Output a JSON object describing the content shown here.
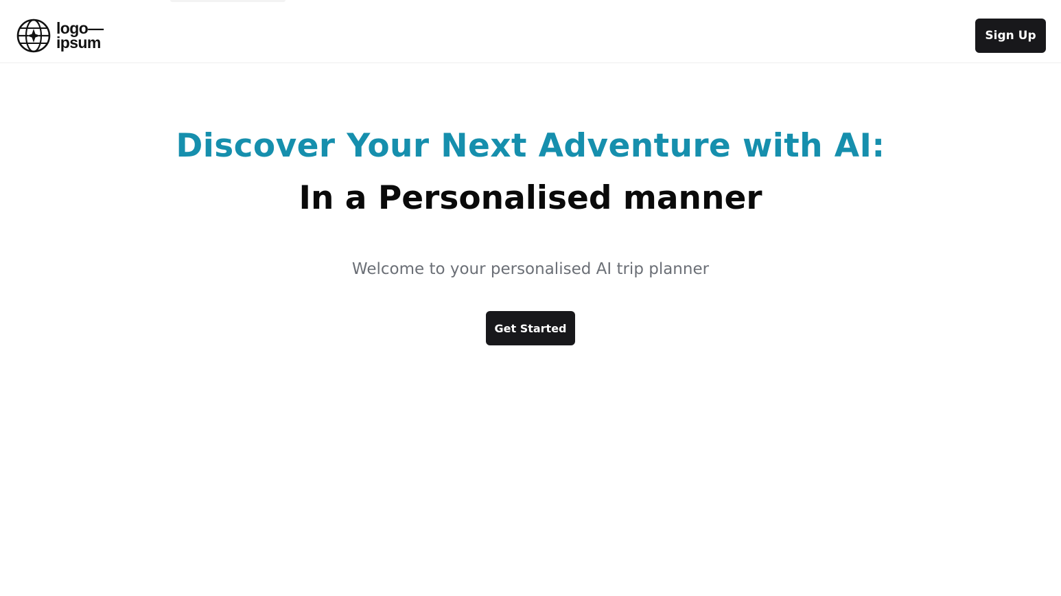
{
  "header": {
    "logo": {
      "line1": "logo—",
      "line2": "ipsum",
      "icon": "globe-star-icon"
    },
    "signup_label": "Sign Up"
  },
  "hero": {
    "title": "Discover Your Next Adventure with AI:",
    "subtitle": "In a Personalised manner",
    "description": "Welcome to your personalised AI trip planner",
    "cta_label": "Get Started"
  },
  "colors": {
    "accent": "#168fad",
    "button_bg": "#18181b",
    "text_muted": "#6b6f76",
    "heading": "#0a0a0a"
  }
}
